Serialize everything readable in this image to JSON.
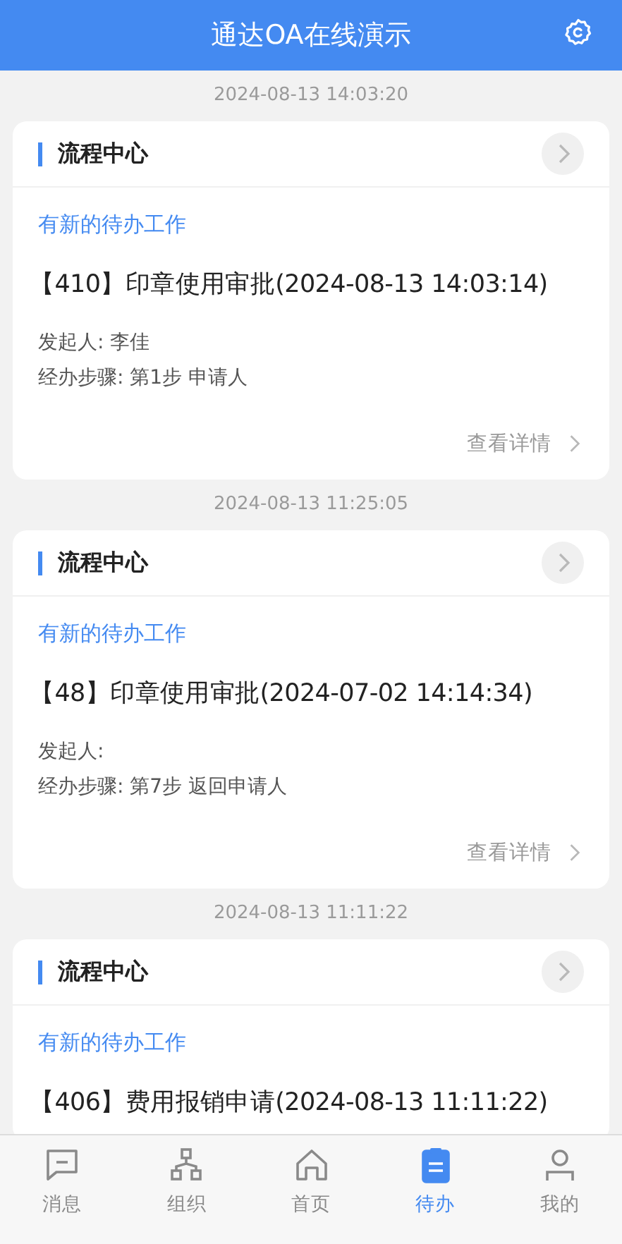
{
  "header": {
    "title": "通达OA在线演示"
  },
  "messages": [
    {
      "time": "2024-08-13 14:03:20",
      "section": "流程中心",
      "notice": "有新的待办工作",
      "title": "【410】印章使用审批(2024-08-13 14:03:14)",
      "lines": [
        "发起人: 李佳",
        "经办步骤: 第1步 申请人"
      ],
      "link": "查看详情"
    },
    {
      "time": "2024-08-13 11:25:05",
      "section": "流程中心",
      "notice": "有新的待办工作",
      "title": "【48】印章使用审批(2024-07-02 14:14:34)",
      "lines": [
        "发起人:",
        "经办步骤: 第7步 返回申请人"
      ],
      "link": "查看详情"
    },
    {
      "time": "2024-08-13 11:11:22",
      "section": "流程中心",
      "notice": "有新的待办工作",
      "title": "【406】费用报销申请(2024-08-13 11:11:22)"
    }
  ],
  "tabs": [
    {
      "kind": "message",
      "label": "消息",
      "selected": false
    },
    {
      "kind": "org",
      "label": "组织",
      "selected": false
    },
    {
      "kind": "home",
      "label": "首页",
      "selected": false
    },
    {
      "kind": "todo",
      "label": "待办",
      "selected": true
    },
    {
      "kind": "me",
      "label": "我的",
      "selected": false
    }
  ]
}
